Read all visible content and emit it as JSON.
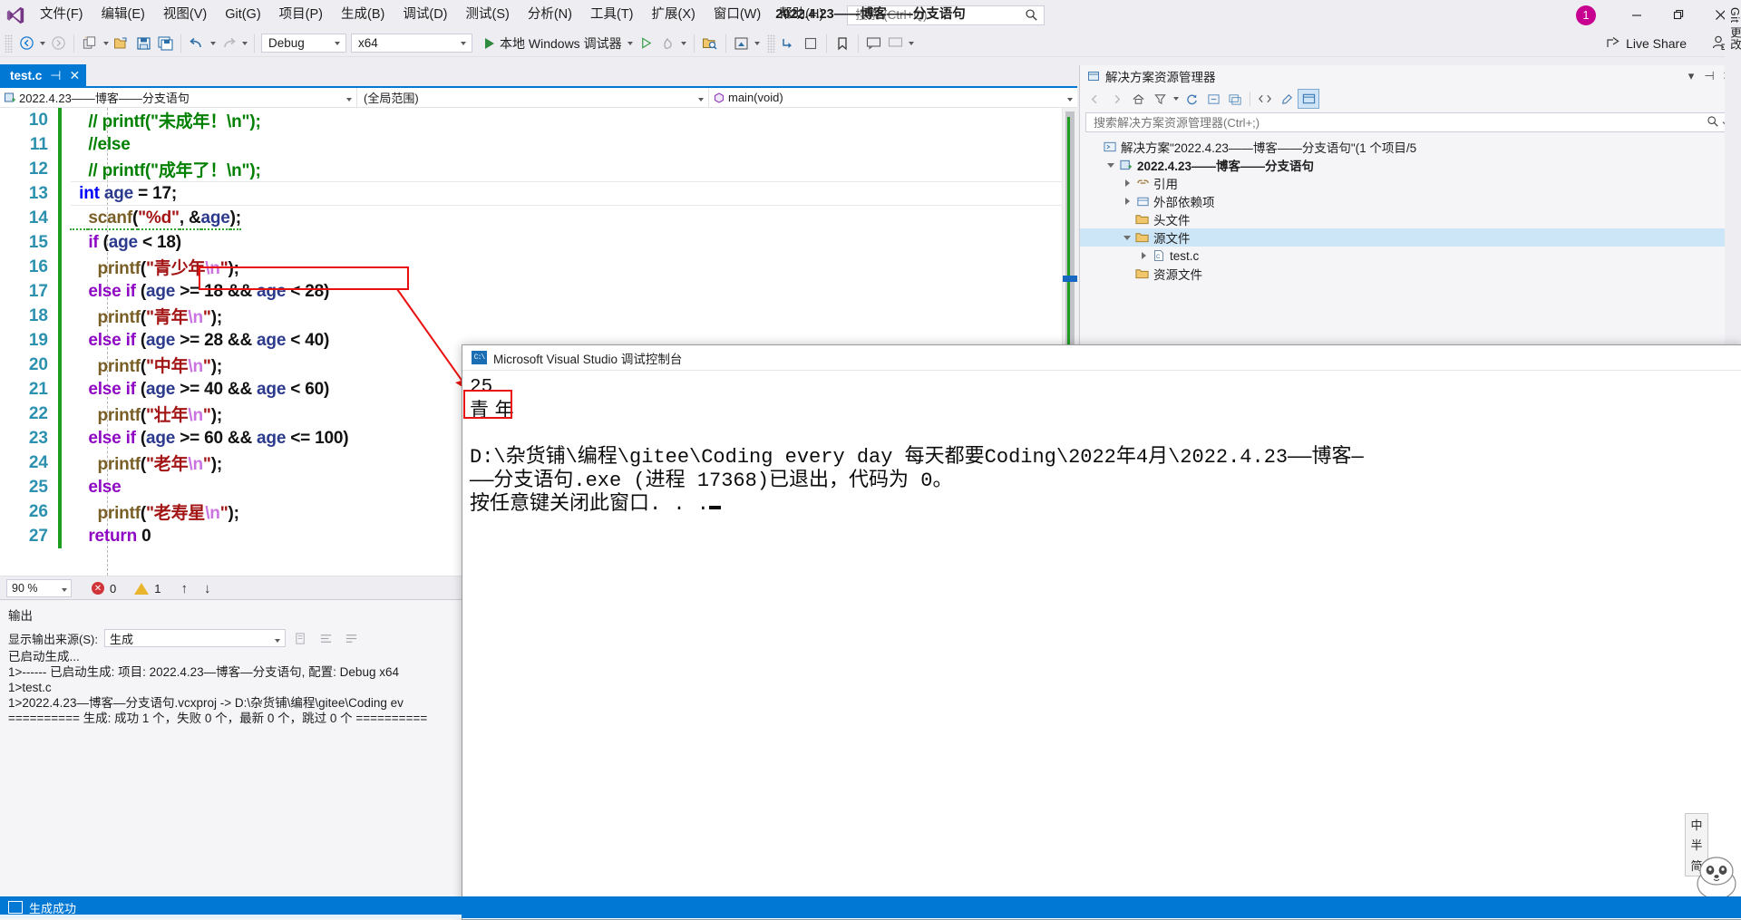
{
  "app": {
    "window_title": "2022.4.23——博客——分支语句",
    "notification_count": "1",
    "live_share": "Live Share"
  },
  "menu": {
    "items": [
      {
        "label": "文件(F)"
      },
      {
        "label": "编辑(E)"
      },
      {
        "label": "视图(V)"
      },
      {
        "label": "Git(G)"
      },
      {
        "label": "项目(P)"
      },
      {
        "label": "生成(B)"
      },
      {
        "label": "调试(D)"
      },
      {
        "label": "测试(S)"
      },
      {
        "label": "分析(N)"
      },
      {
        "label": "工具(T)"
      },
      {
        "label": "扩展(X)"
      },
      {
        "label": "窗口(W)"
      },
      {
        "label": "帮助(H)"
      }
    ],
    "search_placeholder": "搜索 (Ctrl+Q)"
  },
  "toolbar": {
    "configuration": "Debug",
    "platform": "x64",
    "run_label": "本地 Windows 调试器"
  },
  "window_buttons": {
    "minimize": "—",
    "maximize": "❐",
    "close": "✕"
  },
  "editor": {
    "tab_name": "test.c",
    "tab_pin": "⊣",
    "tab_close": "✕",
    "nav_project": "2022.4.23——博客——分支语句",
    "nav_scope": "(全局范围)",
    "nav_function": "main(void)",
    "zoom": "90 %",
    "error_count": "0",
    "warning_count": "1",
    "prev_arrow": "↑",
    "next_arrow": "↓",
    "lines": [
      {
        "num": "10",
        "tokens": [
          {
            "t": "    ",
            "c": "k-plain"
          },
          {
            "t": "// printf(\"未成年！\\n\");",
            "c": "k-green"
          }
        ]
      },
      {
        "num": "11",
        "tokens": [
          {
            "t": "    ",
            "c": "k-plain"
          },
          {
            "t": "//else",
            "c": "k-green"
          }
        ]
      },
      {
        "num": "12",
        "tokens": [
          {
            "t": "    ",
            "c": "k-plain"
          },
          {
            "t": "// printf(\"成年了！\\n\");",
            "c": "k-green"
          }
        ]
      },
      {
        "num": "13",
        "tokens": [
          {
            "t": "  ",
            "c": "k-plain"
          },
          {
            "t": "int",
            "c": "k-kw"
          },
          {
            "t": " ",
            "c": "k-plain"
          },
          {
            "t": "age",
            "c": "k-id"
          },
          {
            "t": " = ",
            "c": "k-plain"
          },
          {
            "t": "17",
            "c": "k-plain"
          },
          {
            "t": ";",
            "c": "k-plain"
          }
        ]
      },
      {
        "num": "14",
        "tokens": [
          {
            "t": "    ",
            "c": "k-plain"
          },
          {
            "t": "scanf",
            "c": "k-fn"
          },
          {
            "t": "(",
            "c": "k-plain"
          },
          {
            "t": "\"%d\"",
            "c": "k-str"
          },
          {
            "t": ", &",
            "c": "k-plain"
          },
          {
            "t": "age",
            "c": "k-id"
          },
          {
            "t": ");",
            "c": "k-plain"
          }
        ]
      },
      {
        "num": "15",
        "tokens": [
          {
            "t": "    ",
            "c": "k-plain"
          },
          {
            "t": "if",
            "c": "k-purple"
          },
          {
            "t": " (",
            "c": "k-plain"
          },
          {
            "t": "age",
            "c": "k-id"
          },
          {
            "t": " < 18)",
            "c": "k-plain"
          }
        ]
      },
      {
        "num": "16",
        "tokens": [
          {
            "t": "      ",
            "c": "k-plain"
          },
          {
            "t": "printf",
            "c": "k-fn"
          },
          {
            "t": "(",
            "c": "k-plain"
          },
          {
            "t": "\"青少年",
            "c": "k-str"
          },
          {
            "t": "\\n",
            "c": "k-esc"
          },
          {
            "t": "\"",
            "c": "k-str"
          },
          {
            "t": ");",
            "c": "k-plain"
          }
        ]
      },
      {
        "num": "17",
        "tokens": [
          {
            "t": "    ",
            "c": "k-plain"
          },
          {
            "t": "else if",
            "c": "k-purple"
          },
          {
            "t": " (",
            "c": "k-plain"
          },
          {
            "t": "age",
            "c": "k-id"
          },
          {
            "t": " >= 18 && ",
            "c": "k-plain"
          },
          {
            "t": "age",
            "c": "k-id"
          },
          {
            "t": " < 28)",
            "c": "k-plain"
          }
        ]
      },
      {
        "num": "18",
        "tokens": [
          {
            "t": "      ",
            "c": "k-plain"
          },
          {
            "t": "printf",
            "c": "k-fn"
          },
          {
            "t": "(",
            "c": "k-plain"
          },
          {
            "t": "\"青年",
            "c": "k-str"
          },
          {
            "t": "\\n",
            "c": "k-esc"
          },
          {
            "t": "\"",
            "c": "k-str"
          },
          {
            "t": ");",
            "c": "k-plain"
          }
        ]
      },
      {
        "num": "19",
        "tokens": [
          {
            "t": "    ",
            "c": "k-plain"
          },
          {
            "t": "else if",
            "c": "k-purple"
          },
          {
            "t": " (",
            "c": "k-plain"
          },
          {
            "t": "age",
            "c": "k-id"
          },
          {
            "t": " >= 28 && ",
            "c": "k-plain"
          },
          {
            "t": "age",
            "c": "k-id"
          },
          {
            "t": " < 40)",
            "c": "k-plain"
          }
        ]
      },
      {
        "num": "20",
        "tokens": [
          {
            "t": "      ",
            "c": "k-plain"
          },
          {
            "t": "printf",
            "c": "k-fn"
          },
          {
            "t": "(",
            "c": "k-plain"
          },
          {
            "t": "\"中年",
            "c": "k-str"
          },
          {
            "t": "\\n",
            "c": "k-esc"
          },
          {
            "t": "\"",
            "c": "k-str"
          },
          {
            "t": ");",
            "c": "k-plain"
          }
        ]
      },
      {
        "num": "21",
        "tokens": [
          {
            "t": "    ",
            "c": "k-plain"
          },
          {
            "t": "else if",
            "c": "k-purple"
          },
          {
            "t": " (",
            "c": "k-plain"
          },
          {
            "t": "age",
            "c": "k-id"
          },
          {
            "t": " >= 40 && ",
            "c": "k-plain"
          },
          {
            "t": "age",
            "c": "k-id"
          },
          {
            "t": " < 60)",
            "c": "k-plain"
          }
        ]
      },
      {
        "num": "22",
        "tokens": [
          {
            "t": "      ",
            "c": "k-plain"
          },
          {
            "t": "printf",
            "c": "k-fn"
          },
          {
            "t": "(",
            "c": "k-plain"
          },
          {
            "t": "\"壮年",
            "c": "k-str"
          },
          {
            "t": "\\n",
            "c": "k-esc"
          },
          {
            "t": "\"",
            "c": "k-str"
          },
          {
            "t": ");",
            "c": "k-plain"
          }
        ]
      },
      {
        "num": "23",
        "tokens": [
          {
            "t": "    ",
            "c": "k-plain"
          },
          {
            "t": "else if",
            "c": "k-purple"
          },
          {
            "t": " (",
            "c": "k-plain"
          },
          {
            "t": "age",
            "c": "k-id"
          },
          {
            "t": " >= 60 && ",
            "c": "k-plain"
          },
          {
            "t": "age",
            "c": "k-id"
          },
          {
            "t": " <= 100)",
            "c": "k-plain"
          }
        ]
      },
      {
        "num": "24",
        "tokens": [
          {
            "t": "      ",
            "c": "k-plain"
          },
          {
            "t": "printf",
            "c": "k-fn"
          },
          {
            "t": "(",
            "c": "k-plain"
          },
          {
            "t": "\"老年",
            "c": "k-str"
          },
          {
            "t": "\\n",
            "c": "k-esc"
          },
          {
            "t": "\"",
            "c": "k-str"
          },
          {
            "t": ");",
            "c": "k-plain"
          }
        ]
      },
      {
        "num": "25",
        "tokens": [
          {
            "t": "    ",
            "c": "k-plain"
          },
          {
            "t": "else",
            "c": "k-purple"
          }
        ]
      },
      {
        "num": "26",
        "tokens": [
          {
            "t": "      ",
            "c": "k-plain"
          },
          {
            "t": "printf",
            "c": "k-fn"
          },
          {
            "t": "(",
            "c": "k-plain"
          },
          {
            "t": "\"老寿星",
            "c": "k-str"
          },
          {
            "t": "\\n",
            "c": "k-esc"
          },
          {
            "t": "\"",
            "c": "k-str"
          },
          {
            "t": ");",
            "c": "k-plain"
          }
        ]
      },
      {
        "num": "27",
        "tokens": [
          {
            "t": "    ",
            "c": "k-plain"
          },
          {
            "t": "return",
            "c": "k-purple"
          },
          {
            "t": " 0",
            "c": "k-plain"
          }
        ]
      }
    ]
  },
  "output": {
    "title": "输出",
    "source_label": "显示输出来源(S):",
    "source_value": "生成",
    "lines": [
      "已启动生成...",
      "1>------ 已启动生成: 项目: 2022.4.23—博客—分支语句, 配置: Debug x64",
      "1>test.c",
      "1>2022.4.23—博客—分支语句.vcxproj -> D:\\杂货铺\\编程\\gitee\\Coding ev",
      "========== 生成: 成功 1 个，失败 0 个，最新 0 个，跳过 0 个 =========="
    ]
  },
  "solution_explorer": {
    "title": "解决方案资源管理器",
    "search_placeholder": "搜索解决方案资源管理器(Ctrl+;)",
    "git_tab": "Git 更改",
    "tree": [
      {
        "label": "解决方案\"2022.4.23——博客——分支语句\"(1 个项目/5",
        "depth": 0,
        "icon": "solution",
        "expander": "none",
        "bold": false
      },
      {
        "label": "2022.4.23——博客——分支语句",
        "depth": 1,
        "icon": "project",
        "expander": "open",
        "bold": true
      },
      {
        "label": "引用",
        "depth": 2,
        "icon": "references",
        "expander": "closed",
        "bold": false
      },
      {
        "label": "外部依赖项",
        "depth": 2,
        "icon": "deps",
        "expander": "closed",
        "bold": false
      },
      {
        "label": "头文件",
        "depth": 2,
        "icon": "folder",
        "expander": "none",
        "bold": false
      },
      {
        "label": "源文件",
        "depth": 2,
        "icon": "folder",
        "expander": "open",
        "bold": false,
        "selected": true
      },
      {
        "label": "test.c",
        "depth": 3,
        "icon": "cfile",
        "expander": "closed",
        "bold": false
      },
      {
        "label": "资源文件",
        "depth": 2,
        "icon": "folder",
        "expander": "none",
        "bold": false
      }
    ]
  },
  "console": {
    "title": "Microsoft Visual Studio 调试控制台",
    "input_value": "25",
    "result": "青 年",
    "exit_line_1": "D:\\杂货铺\\编程\\gitee\\Coding every day 每天都要Coding\\2022年4月\\2022.4.23——博客—",
    "exit_line_2": "——分支语句.exe (进程 17368)已退出，代码为 0。",
    "prompt": "按任意键关闭此窗口. . ."
  },
  "ime": {
    "chars": [
      "中",
      "半",
      "简"
    ]
  },
  "statusbar": {
    "message": "生成成功"
  },
  "colors": {
    "accent": "#0078d4",
    "badge": "#c8008f",
    "annotation_red": "#e8110f",
    "changebar_green": "#1f9d1f"
  }
}
